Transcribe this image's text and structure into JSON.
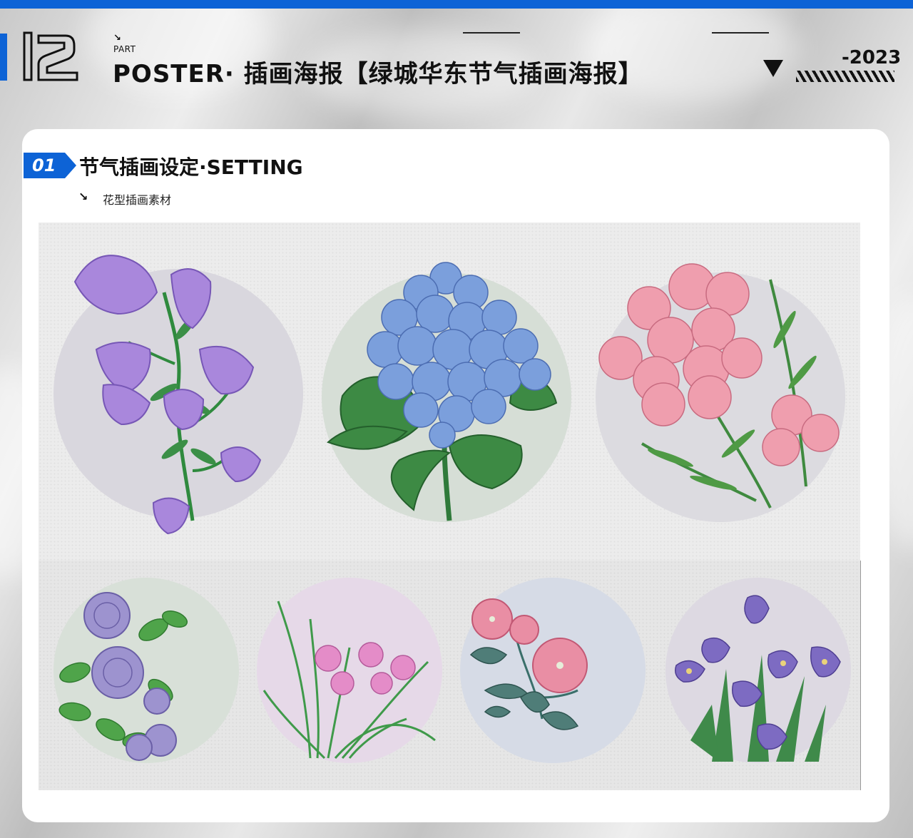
{
  "header": {
    "number": "12",
    "part_arrow": "↘",
    "part_label": "PART",
    "title": "POSTER· 插画海报【绿城华东节气插画海报】",
    "year": "-2023"
  },
  "colors": {
    "accent": "#0d63d6",
    "text": "#111111",
    "card": "#ffffff"
  },
  "section": {
    "number": "01",
    "title": "节气插画设定·SETTING",
    "sub_arrow": "↘",
    "subtitle": "花型插画素材"
  },
  "illustrations": {
    "top_row": [
      "bellflower-illustration",
      "hydrangea-illustration",
      "phlox-illustration"
    ],
    "bottom_row": [
      "rose-illustration",
      "rain-lily-illustration",
      "hibiscus-illustration",
      "iris-illustration"
    ]
  }
}
